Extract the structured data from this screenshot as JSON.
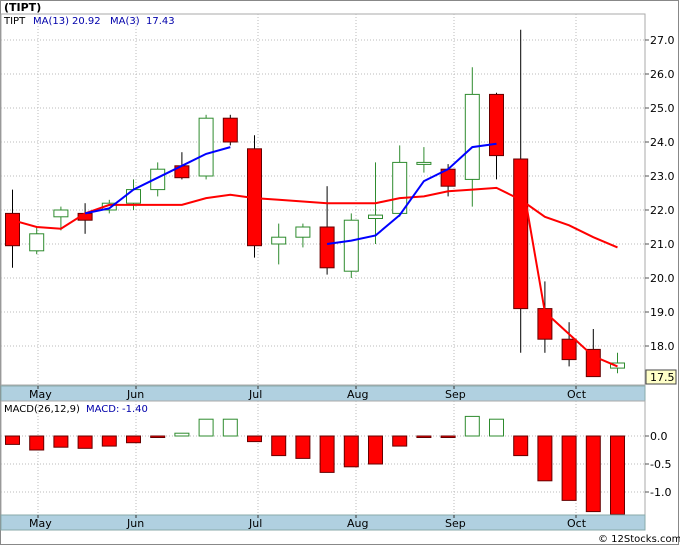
{
  "title": "(TIPT)",
  "watermark": "© 12Stocks.com",
  "colors": {
    "up": "#2e8b2e",
    "down": "#ff0000",
    "downEdge": "#660000",
    "ma13": "#0000ff",
    "ma3": "#ff0000",
    "axisBar": "#b0d0e0",
    "grid": "#bbbbbb",
    "priceTag": "#ffffc8"
  },
  "chart_data": [
    {
      "type": "candlestick",
      "ticker": "TIPT",
      "ma_legend": {
        "ticker": "TIPT",
        "ma13_label": "MA(13)",
        "ma13_value": "20.92",
        "ma3_label": "MA(3)",
        "ma3_value": "17.43"
      },
      "last_price": "17.5",
      "months": [
        "May",
        "Jun",
        "Jul",
        "Aug",
        "Sep",
        "Oct"
      ],
      "y_ticks": [
        "18.0",
        "19.0",
        "20.0",
        "21.0",
        "22.0",
        "23.0",
        "24.0",
        "25.0",
        "26.0",
        "27.0"
      ],
      "ylim": [
        16.6,
        27.6
      ],
      "grid": true,
      "candles": [
        {
          "o": 21.9,
          "h": 22.6,
          "l": 20.3,
          "c": 20.95
        },
        {
          "o": 20.8,
          "h": 21.5,
          "l": 20.7,
          "c": 21.3
        },
        {
          "o": 21.8,
          "h": 22.1,
          "l": 21.4,
          "c": 22.0
        },
        {
          "o": 21.9,
          "h": 22.2,
          "l": 21.3,
          "c": 21.7
        },
        {
          "o": 22.0,
          "h": 22.3,
          "l": 21.9,
          "c": 22.2
        },
        {
          "o": 22.2,
          "h": 22.9,
          "l": 22.0,
          "c": 22.6
        },
        {
          "o": 22.6,
          "h": 23.4,
          "l": 22.4,
          "c": 23.2
        },
        {
          "o": 23.3,
          "h": 23.7,
          "l": 22.9,
          "c": 22.95
        },
        {
          "o": 23.0,
          "h": 24.8,
          "l": 22.9,
          "c": 24.7
        },
        {
          "o": 24.7,
          "h": 24.8,
          "l": 23.9,
          "c": 24.0
        },
        {
          "o": 23.8,
          "h": 24.2,
          "l": 20.6,
          "c": 20.95
        },
        {
          "o": 21.0,
          "h": 21.6,
          "l": 20.4,
          "c": 21.2
        },
        {
          "o": 21.2,
          "h": 21.6,
          "l": 20.9,
          "c": 21.5
        },
        {
          "o": 21.5,
          "h": 22.7,
          "l": 20.1,
          "c": 20.3
        },
        {
          "o": 20.2,
          "h": 21.9,
          "l": 20.0,
          "c": 21.7
        },
        {
          "o": 21.75,
          "h": 23.4,
          "l": 21.0,
          "c": 21.85
        },
        {
          "o": 21.9,
          "h": 23.9,
          "l": 21.8,
          "c": 23.4
        },
        {
          "o": 23.4,
          "h": 23.85,
          "l": 23.1,
          "c": 23.4
        },
        {
          "o": 23.2,
          "h": 23.35,
          "l": 22.4,
          "c": 22.7
        },
        {
          "o": 22.9,
          "h": 26.2,
          "l": 22.1,
          "c": 25.4
        },
        {
          "o": 25.4,
          "h": 25.45,
          "l": 22.9,
          "c": 23.6
        },
        {
          "o": 23.5,
          "h": 27.3,
          "l": 17.8,
          "c": 19.1
        },
        {
          "o": 19.1,
          "h": 19.9,
          "l": 17.8,
          "c": 18.2
        },
        {
          "o": 18.2,
          "h": 18.7,
          "l": 17.4,
          "c": 17.6
        },
        {
          "o": 17.9,
          "h": 18.5,
          "l": 17.2,
          "c": 17.1
        },
        {
          "o": 17.35,
          "h": 17.8,
          "l": 17.2,
          "c": 17.5
        }
      ],
      "ma3": [
        21.7,
        21.5,
        21.45,
        21.9,
        22.15,
        22.15,
        22.15,
        22.15,
        22.35,
        22.45,
        22.35,
        22.3,
        22.25,
        22.2,
        22.2,
        22.2,
        22.35,
        22.4,
        22.55,
        22.6,
        22.65,
        22.3,
        21.8,
        21.55,
        21.2,
        20.9
      ],
      "ma13": [
        null,
        21.75,
        null,
        21.9,
        22.05,
        22.6,
        22.95,
        23.3,
        23.65,
        23.85,
        null,
        null,
        null,
        21.0,
        21.1,
        21.25,
        21.85,
        22.85,
        23.2,
        23.85,
        23.95,
        null,
        null,
        null,
        null,
        null
      ],
      "ma13_tail": [
        19.0,
        18.35,
        17.7,
        17.4
      ]
    },
    {
      "type": "bar",
      "title": "MACD",
      "legend": {
        "params": "MACD(26,12,9)",
        "label": "MACD:",
        "value": "-1.40"
      },
      "months": [
        "May",
        "Jun",
        "Jul",
        "Aug",
        "Sep",
        "Oct"
      ],
      "y_ticks": [
        "0.0",
        "-0.5",
        "-1.0"
      ],
      "ylim": [
        -1.45,
        0.35
      ],
      "values": [
        -0.15,
        -0.25,
        -0.2,
        -0.22,
        -0.18,
        -0.12,
        0.0,
        0.05,
        0.3,
        0.3,
        -0.1,
        -0.35,
        -0.4,
        -0.65,
        -0.55,
        -0.5,
        -0.18,
        0.0,
        0.0,
        0.35,
        0.3,
        -0.35,
        -0.8,
        -1.15,
        -1.35,
        -1.4
      ]
    }
  ]
}
